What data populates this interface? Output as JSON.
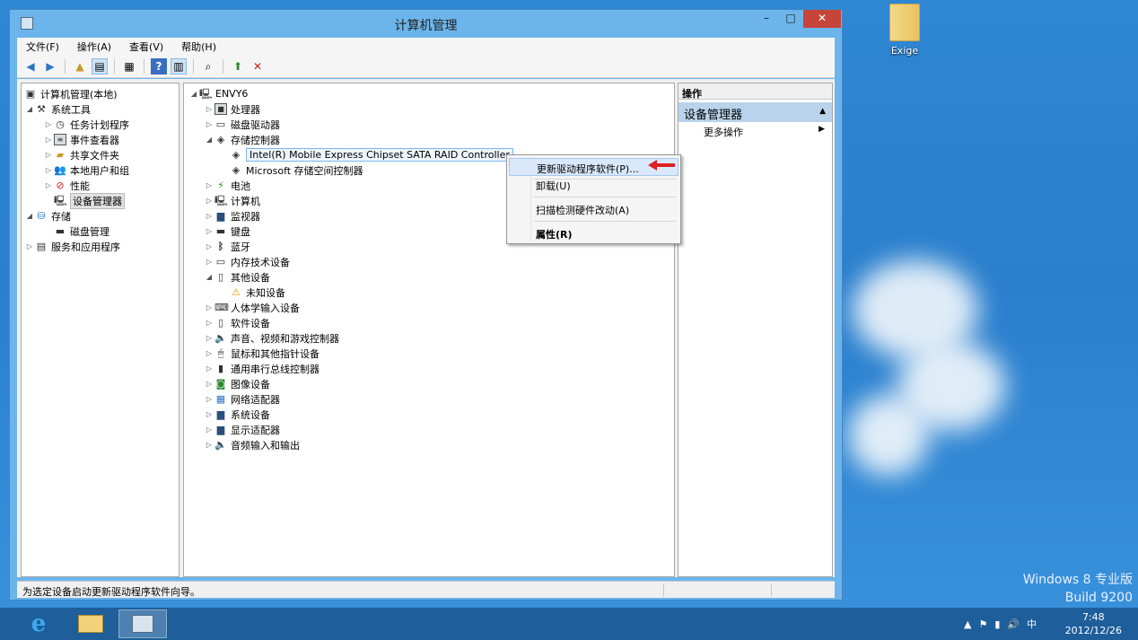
{
  "desktop": {
    "icon_label": "Exige",
    "brand_line1": "Windows 8 专业版",
    "brand_line2": "Build 9200"
  },
  "window": {
    "title": "计算机管理",
    "min_glyph": "–",
    "max_glyph": "□",
    "close_glyph": "✕",
    "menu": [
      "文件(F)",
      "操作(A)",
      "查看(V)",
      "帮助(H)"
    ],
    "toolbar_icons": [
      "back-icon",
      "forward-icon",
      "up-icon",
      "show-hide-tree-icon",
      "properties-icon",
      "help-icon",
      "action-pane-icon",
      "scan-icon",
      "update-driver-icon",
      "uninstall-icon"
    ]
  },
  "left_tree": {
    "root": "计算机管理(本地)",
    "system_tools": "系统工具",
    "task_scheduler": "任务计划程序",
    "event_viewer": "事件查看器",
    "shared_folders": "共享文件夹",
    "local_users": "本地用户和组",
    "performance": "性能",
    "device_manager": "设备管理器",
    "storage": "存储",
    "disk_management": "磁盘管理",
    "services_apps": "服务和应用程序"
  },
  "device_tree": {
    "root": "ENVY6",
    "processors": "处理器",
    "disk_drives": "磁盘驱动器",
    "storage_controllers": "存储控制器",
    "intel_controller": "Intel(R) Mobile Express Chipset SATA RAID Controller",
    "ms_controller": "Microsoft 存储空间控制器",
    "battery": "电池",
    "computer": "计算机",
    "monitors": "监视器",
    "keyboards": "键盘",
    "bluetooth": "蓝牙",
    "memory_tech": "内存技术设备",
    "other_devices": "其他设备",
    "unknown_device": "未知设备",
    "hid": "人体学输入设备",
    "software_devices": "软件设备",
    "sound": "声音、视频和游戏控制器",
    "mice": "鼠标和其他指针设备",
    "usb": "通用串行总线控制器",
    "imaging": "图像设备",
    "network": "网络适配器",
    "system_devices": "系统设备",
    "display": "显示适配器",
    "audio_io": "音频输入和输出"
  },
  "actions": {
    "header": "操作",
    "section": "设备管理器",
    "more": "更多操作"
  },
  "context_menu": {
    "update_driver": "更新驱动程序软件(P)...",
    "uninstall": "卸载(U)",
    "scan": "扫描检测硬件改动(A)",
    "properties": "属性(R)"
  },
  "status": {
    "text": "为选定设备启动更新驱动程序软件向导。"
  },
  "taskbar": {
    "ie_glyph": "e",
    "ime": "中",
    "time": "7:48",
    "date": "2012/12/26"
  },
  "colors": {
    "desktop": "#2b7fcd",
    "window_frame": "#6cb5ec",
    "close_button": "#c7443a",
    "menu_highlight": "#d9e8fb",
    "red_arrow": "#e02020"
  }
}
